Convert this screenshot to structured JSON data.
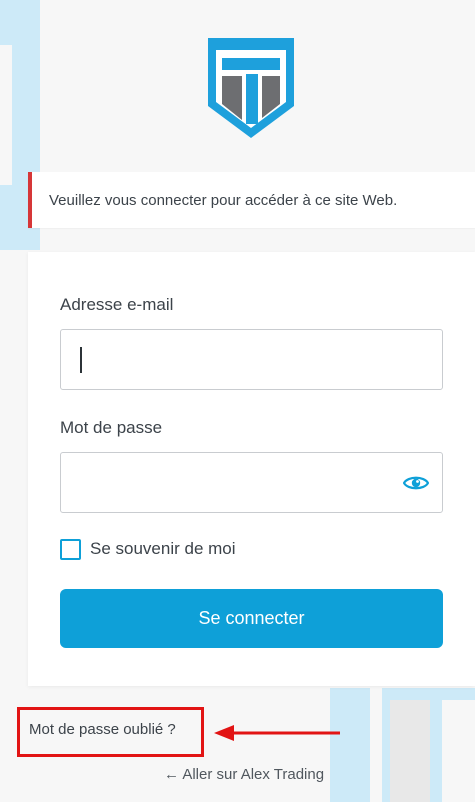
{
  "colors": {
    "accent": "#0ea0d8",
    "notice_border": "#d63638",
    "highlight": "#e21414",
    "logo_blue": "#1ea0dc",
    "logo_gray": "#6d6e71"
  },
  "icons": {
    "logo": "shield-t-logo",
    "password_toggle": "eye-icon",
    "arrow": "arrow-left-icon"
  },
  "notice": {
    "message": "Veuillez vous connecter pour accéder à ce site Web."
  },
  "form": {
    "email_label": "Adresse e-mail",
    "email_value": "",
    "password_label": "Mot de passe",
    "password_value": "",
    "remember_label": "Se souvenir de moi",
    "remember_checked": false,
    "submit_label": "Se connecter"
  },
  "links": {
    "lost_password": "Mot de passe oublié ?",
    "back_to_site": "← Aller sur Alex Trading"
  }
}
